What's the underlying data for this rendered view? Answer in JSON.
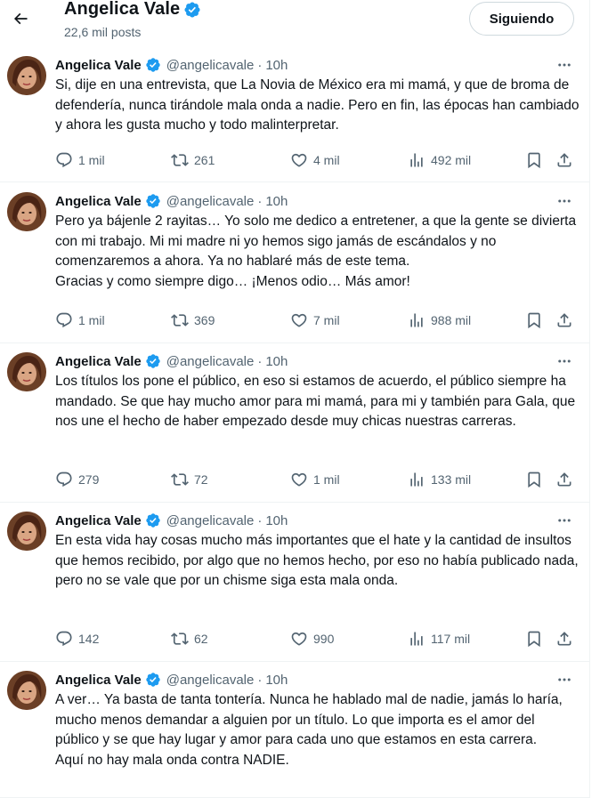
{
  "header": {
    "name": "Angelica Vale",
    "posts": "22,6 mil posts",
    "follow_label": "Siguiendo"
  },
  "tweets": [
    {
      "name": "Angelica Vale",
      "handle": "@angelicavale",
      "dot": "·",
      "time": "10h",
      "text": "Si, dije en una entrevista, que La Novia de México era mi mamá, y que de broma de defendería, nunca tirándole mala onda a nadie. Pero en fin, las épocas han cambiado y ahora les gusta mucho y todo malinterpretar.",
      "replies": "1 mil",
      "reposts": "261",
      "likes": "4 mil",
      "views": "492 mil"
    },
    {
      "name": "Angelica Vale",
      "handle": "@angelicavale",
      "dot": "·",
      "time": "10h",
      "text": "Pero ya bájenle 2 rayitas… Yo solo me dedico a entretener, a que la gente se divierta con mi trabajo. Mi mi madre ni yo hemos sigo jamás de escándalos y no comenzaremos a ahora. Ya no hablaré más de este tema.\nGracias y como siempre digo… ¡Menos odio… Más amor!",
      "replies": "1 mil",
      "reposts": "369",
      "likes": "7 mil",
      "views": "988 mil"
    },
    {
      "name": "Angelica Vale",
      "handle": "@angelicavale",
      "dot": "·",
      "time": "10h",
      "text": "Los títulos los pone el público, en eso si estamos de acuerdo, el público siempre ha mandado. Se que hay mucho amor para mi mamá, para mi y también para Gala, que nos une el hecho de haber empezado desde muy chicas nuestras carreras.",
      "replies": "279",
      "reposts": "72",
      "likes": "1 mil",
      "views": "133 mil"
    },
    {
      "name": "Angelica Vale",
      "handle": "@angelicavale",
      "dot": "·",
      "time": "10h",
      "text": "En esta vida hay cosas mucho más importantes que el hate y la cantidad de insultos que hemos recibido, por algo que no hemos hecho, por eso no había publicado nada, pero no se vale que por un chisme siga esta mala onda.",
      "replies": "142",
      "reposts": "62",
      "likes": "990",
      "views": "117 mil"
    },
    {
      "name": "Angelica Vale",
      "handle": "@angelicavale",
      "dot": "·",
      "time": "10h",
      "text": "A ver… Ya basta de tanta tontería. Nunca he hablado mal de nadie, jamás lo haría, mucho menos demandar a alguien por un título. Lo que importa es el amor del público y se que hay lugar y amor para cada uno que estamos en esta carrera.\nAquí no hay mala onda contra NADIE.",
      "replies": "",
      "reposts": "",
      "likes": "",
      "views": ""
    }
  ],
  "colors": {
    "verified": "#1d9bf0",
    "secondary_text": "#536471",
    "primary_text": "#0f1419",
    "divider": "#eff3f4"
  },
  "icons": [
    "back-arrow-icon",
    "verified-badge-icon",
    "more-icon",
    "reply-icon",
    "repost-icon",
    "like-icon",
    "views-icon",
    "bookmark-icon",
    "share-icon"
  ]
}
